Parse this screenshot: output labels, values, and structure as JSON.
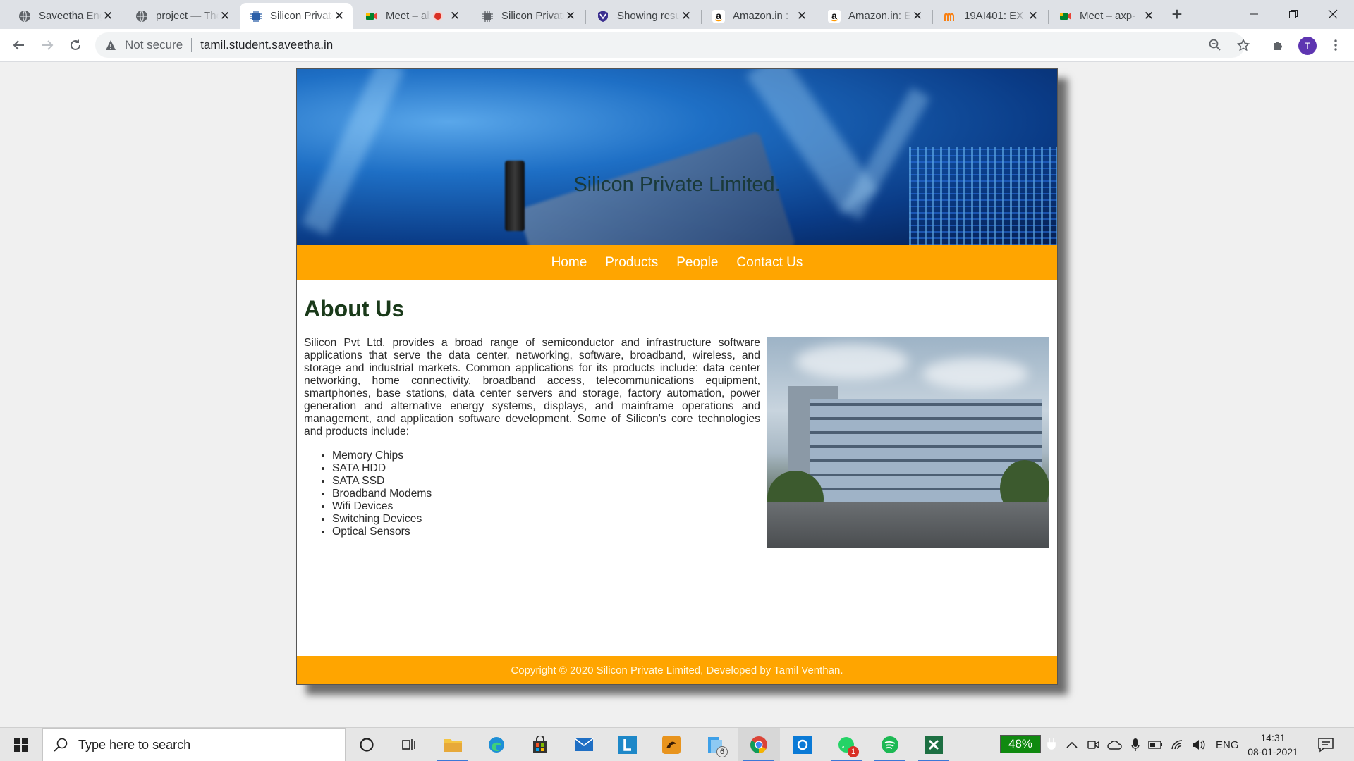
{
  "browser": {
    "tabs": [
      {
        "title": "Saveetha Engineering College",
        "icon": "globe-icon",
        "active": false
      },
      {
        "title": "project — Thonny",
        "icon": "globe-icon",
        "active": false
      },
      {
        "title": "Silicon Private Limited",
        "icon": "chip-icon",
        "active": true
      },
      {
        "title": "Meet – abc",
        "icon": "meet-icon",
        "recording": true,
        "active": false
      },
      {
        "title": "Silicon Private Limited",
        "icon": "chip-icon",
        "active": false
      },
      {
        "title": "Showing results",
        "icon": "shield-icon",
        "active": false
      },
      {
        "title": "Amazon.in : ",
        "icon": "amazon-icon",
        "active": false
      },
      {
        "title": "Amazon.in: Electronics",
        "icon": "amazon-icon",
        "active": false
      },
      {
        "title": "19AI401: EX",
        "icon": "moodle-icon",
        "active": false
      },
      {
        "title": "Meet – axp-",
        "icon": "meet-icon",
        "active": false
      }
    ],
    "address": {
      "security_label": "Not secure",
      "url": "tamil.student.saveetha.in"
    },
    "profile_initial": "T"
  },
  "site": {
    "title": "Silicon Private Limited.",
    "nav": [
      "Home",
      "Products",
      "People",
      "Contact Us"
    ],
    "heading": "About Us",
    "about": "Silicon Pvt Ltd, provides a broad range of semiconductor and infrastructure software applications that serve the data center, networking, software, broadband, wireless, and storage and industrial markets. Common applications for its products include: data center networking, home connectivity, broadband access, telecommunications equipment, smartphones, base stations, data center servers and storage, factory automation, power generation and alternative energy systems, displays, and mainframe operations and management, and application software development. Some of Silicon's core technologies and products include:",
    "products": [
      "Memory Chips",
      "SATA HDD",
      "SATA SSD",
      "Broadband Modems",
      "Wifi Devices",
      "Switching Devices",
      "Optical Sensors"
    ],
    "footer": "Copyright © 2020 Silicon Private Limited, Developed by Tamil Venthan."
  },
  "taskbar": {
    "search_placeholder": "Type here to search",
    "file_explorer_badge": "6",
    "whatsapp_badge": "1",
    "battery": "48%",
    "language": "ENG",
    "time": "14:31",
    "date": "08-01-2021"
  }
}
